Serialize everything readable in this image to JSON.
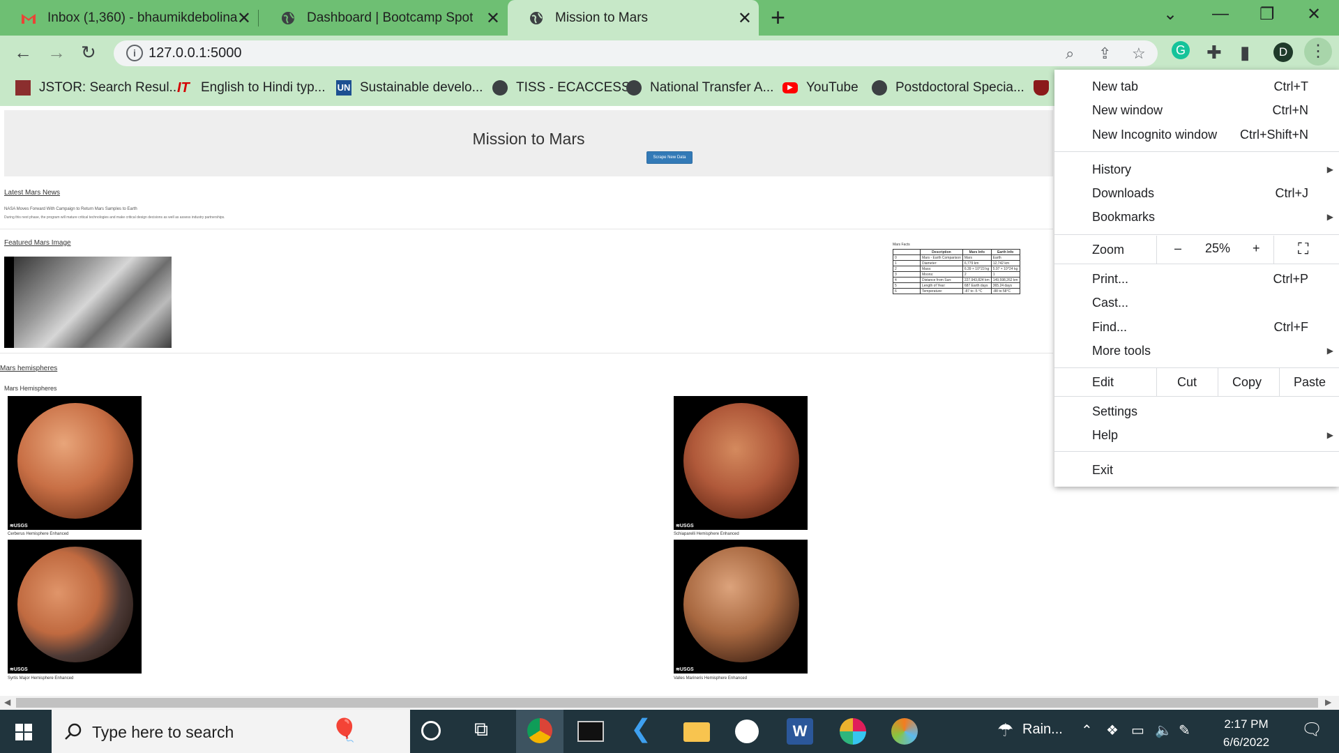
{
  "browser": {
    "tabs": [
      {
        "title": "Inbox (1,360) - bhaumikdebolina",
        "icon": "gmail-icon"
      },
      {
        "title": "Dashboard | Bootcamp Spot",
        "icon": "globe-icon"
      },
      {
        "title": "Mission to Mars",
        "icon": "globe-icon"
      }
    ],
    "url": "127.0.0.1:5000",
    "profile_initial": "D",
    "bookmarks": [
      {
        "label": "JSTOR: Search Resul...",
        "icon": "jstor-icon"
      },
      {
        "label": "English to Hindi typ...",
        "icon": "it-icon"
      },
      {
        "label": "Sustainable develo...",
        "icon": "un-icon"
      },
      {
        "label": "TISS - ECACCESS",
        "icon": "globe-icon"
      },
      {
        "label": "National Transfer A...",
        "icon": "globe-icon"
      },
      {
        "label": "YouTube",
        "icon": "youtube-icon"
      },
      {
        "label": "Postdoctoral Specia...",
        "icon": "globe-icon"
      }
    ]
  },
  "page": {
    "title": "Mission to Mars",
    "scrape_button": "Scrape New Data",
    "news_heading": "Latest Mars News",
    "news_title": "NASA Moves Forward With Campaign to Return Mars Samples to Earth",
    "news_para": "During this next phase, the program will mature critical technologies and make critical design decisions as well as assess industry partnerships.",
    "featured_heading": "Featured Mars Image",
    "facts_caption": "Mars Facts",
    "facts_headers": [
      "Description",
      "Mars Info",
      "Earth Info"
    ],
    "facts_rows": [
      [
        "Mars - Earth Comparison",
        "Mars",
        "Earth"
      ],
      [
        "Diameter:",
        "6,779 km",
        "12,742 km"
      ],
      [
        "Mass:",
        "6.39 × 10^23 kg",
        "5.97 × 10^24 kg"
      ],
      [
        "Moons:",
        "2",
        "1"
      ],
      [
        "Distance from Sun:",
        "227,943,824 km",
        "149,598,262 km"
      ],
      [
        "Length of Year:",
        "687 Earth days",
        "365.24 days"
      ],
      [
        "Temperature:",
        "-87 to -5 °C",
        "-88 to 58°C"
      ]
    ],
    "hemispheres_heading": "Mars hemispheres",
    "hemispheres_subheading": "Mars Hemispheres",
    "usgs": "≋USGS",
    "hemispheres": [
      {
        "title": "Cerberus Hemisphere Enhanced"
      },
      {
        "title": "Schiaparelli Hemisphere Enhanced"
      },
      {
        "title": "Syrtis Major Hemisphere Enhanced"
      },
      {
        "title": "Valles Marineris Hemisphere Enhanced"
      }
    ]
  },
  "menu": {
    "new_tab": "New tab",
    "new_tab_sc": "Ctrl+T",
    "new_window": "New window",
    "new_window_sc": "Ctrl+N",
    "incognito": "New Incognito window",
    "incognito_sc": "Ctrl+Shift+N",
    "history": "History",
    "downloads": "Downloads",
    "downloads_sc": "Ctrl+J",
    "bookmarks": "Bookmarks",
    "zoom": "Zoom",
    "zoom_minus": "–",
    "zoom_value": "25%",
    "zoom_plus": "+",
    "print": "Print...",
    "print_sc": "Ctrl+P",
    "cast": "Cast...",
    "find": "Find...",
    "find_sc": "Ctrl+F",
    "more_tools": "More tools",
    "edit": "Edit",
    "cut": "Cut",
    "copy": "Copy",
    "paste": "Paste",
    "settings": "Settings",
    "help": "Help",
    "exit": "Exit"
  },
  "taskbar": {
    "search_placeholder": "Type here to search",
    "weather": "Rain...",
    "time": "2:17 PM",
    "date": "6/6/2022"
  },
  "colors": {
    "tabstrip": "#6ebf73",
    "toolbar": "#c7e8c8",
    "taskbar": "#20343d",
    "button": "#337ab7"
  }
}
